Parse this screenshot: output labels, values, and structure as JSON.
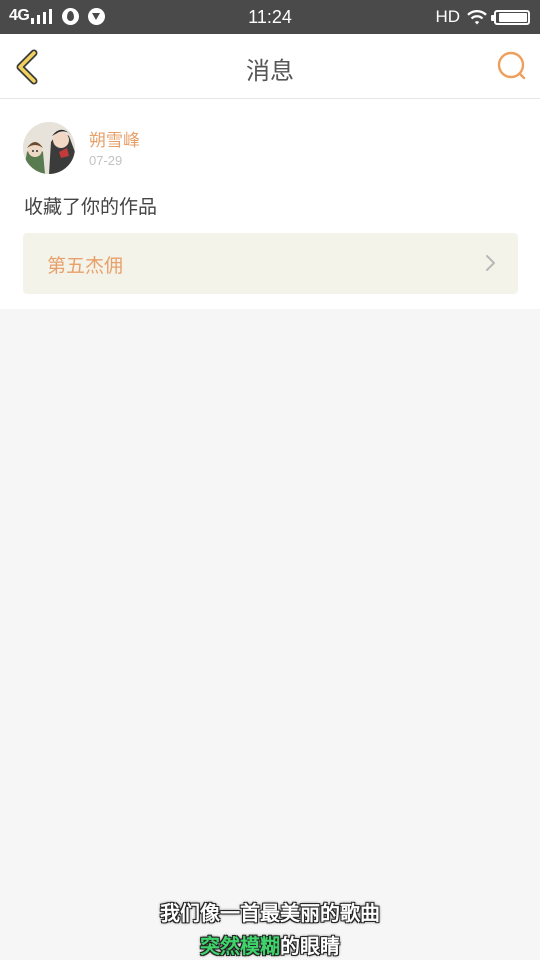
{
  "status_bar": {
    "network": "4G",
    "time": "11:24",
    "hd": "HD",
    "battery_level": 0.95,
    "icons": [
      "signal-icon",
      "app-notification-icon",
      "download-icon",
      "wifi-icon",
      "battery-icon"
    ]
  },
  "nav": {
    "title": "消息",
    "back_icon": "chevron-left-icon",
    "search_icon": "search-icon"
  },
  "message": {
    "username": "朔雪峰",
    "date": "07-29",
    "text": "收藏了你的作品",
    "work_title": "第五杰佣"
  },
  "subtitle": {
    "line1": "我们像一首最美丽的歌曲",
    "line2_highlight": "突然模糊",
    "line2_rest": "的眼睛"
  },
  "colors": {
    "status_bar_bg": "#4a4a4a",
    "accent_orange": "#e8a06a",
    "back_arrow_yellow": "#f2d25e",
    "work_card_bg": "#f4f3ea",
    "subtitle_green": "#3fd36b"
  }
}
